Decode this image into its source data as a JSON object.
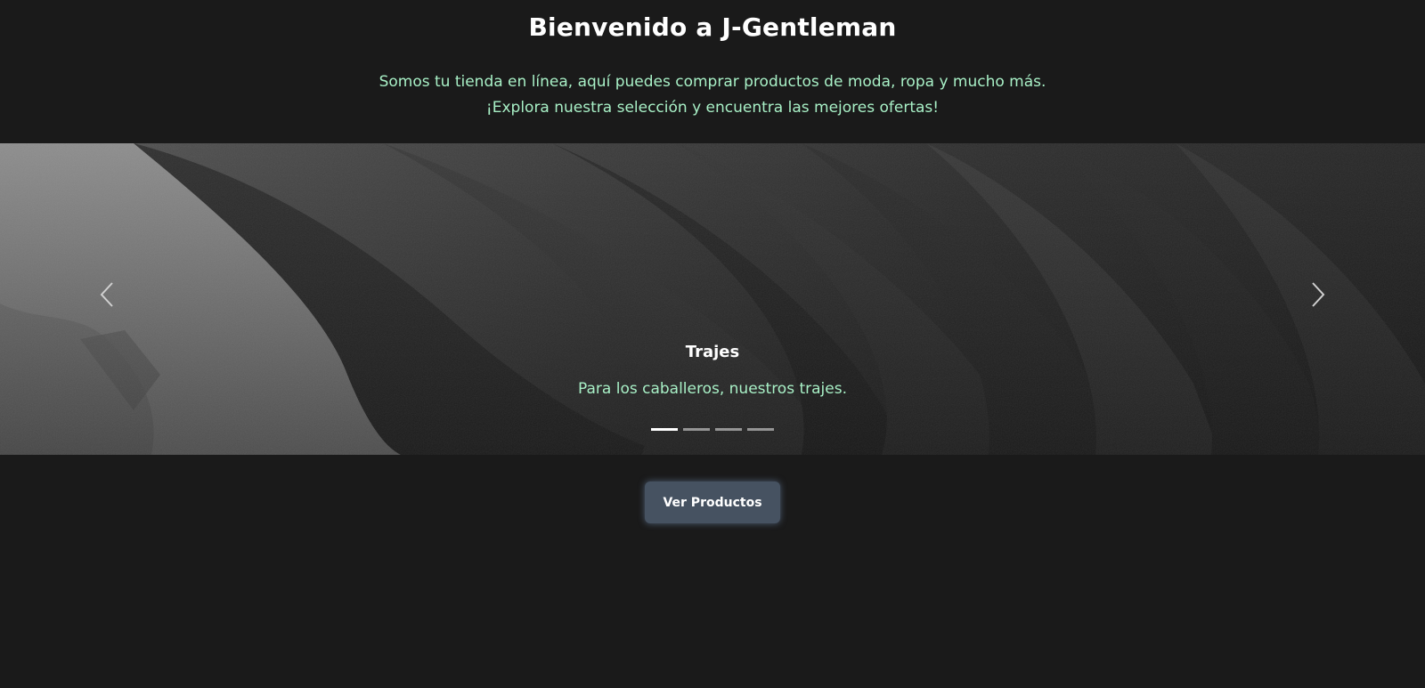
{
  "header": {
    "title": "Bienvenido a J-Gentleman",
    "description_line1": "Somos tu tienda en línea, aquí puedes comprar productos de moda, ropa y mucho más.",
    "description_line2": "¡Explora nuestra selección y encuentra las mejores ofertas!"
  },
  "carousel": {
    "active_index": 0,
    "slide_count": 4,
    "slide": {
      "title": "Trajes",
      "text": "Para los caballeros, nuestros trajes."
    },
    "prev_icon": "chevron-left-icon",
    "next_icon": "chevron-right-icon"
  },
  "cta": {
    "label": "Ver Productos"
  },
  "colors": {
    "background": "#1a1a1a",
    "accent_text": "#a8f0c6",
    "button": "#465261"
  }
}
